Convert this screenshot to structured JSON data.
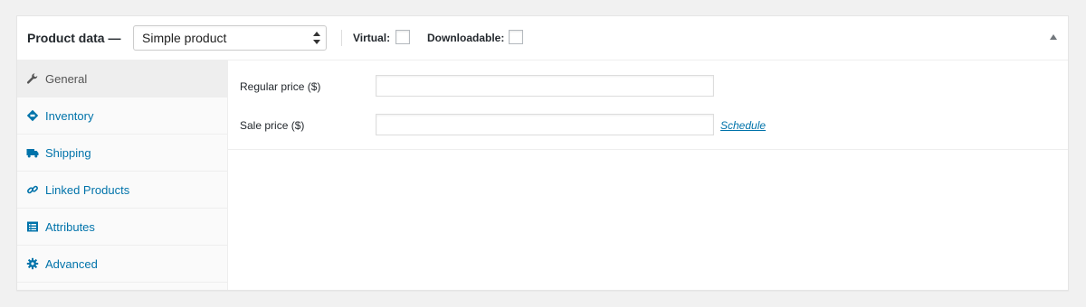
{
  "header": {
    "title": "Product data —",
    "product_type": "Simple product",
    "virtual_label": "Virtual:",
    "downloadable_label": "Downloadable:"
  },
  "sidebar": {
    "items": [
      {
        "label": "General",
        "icon": "wrench-icon",
        "active": true
      },
      {
        "label": "Inventory",
        "icon": "tag-icon",
        "active": false
      },
      {
        "label": "Shipping",
        "icon": "truck-icon",
        "active": false
      },
      {
        "label": "Linked Products",
        "icon": "link-icon",
        "active": false
      },
      {
        "label": "Attributes",
        "icon": "list-icon",
        "active": false
      },
      {
        "label": "Advanced",
        "icon": "gear-icon",
        "active": false
      }
    ]
  },
  "general": {
    "regular_price_label": "Regular price ($)",
    "regular_price_value": "",
    "sale_price_label": "Sale price ($)",
    "sale_price_value": "",
    "schedule_link": "Schedule"
  },
  "colors": {
    "link": "#0073aa",
    "active_tab_bg": "#eeeeee"
  }
}
